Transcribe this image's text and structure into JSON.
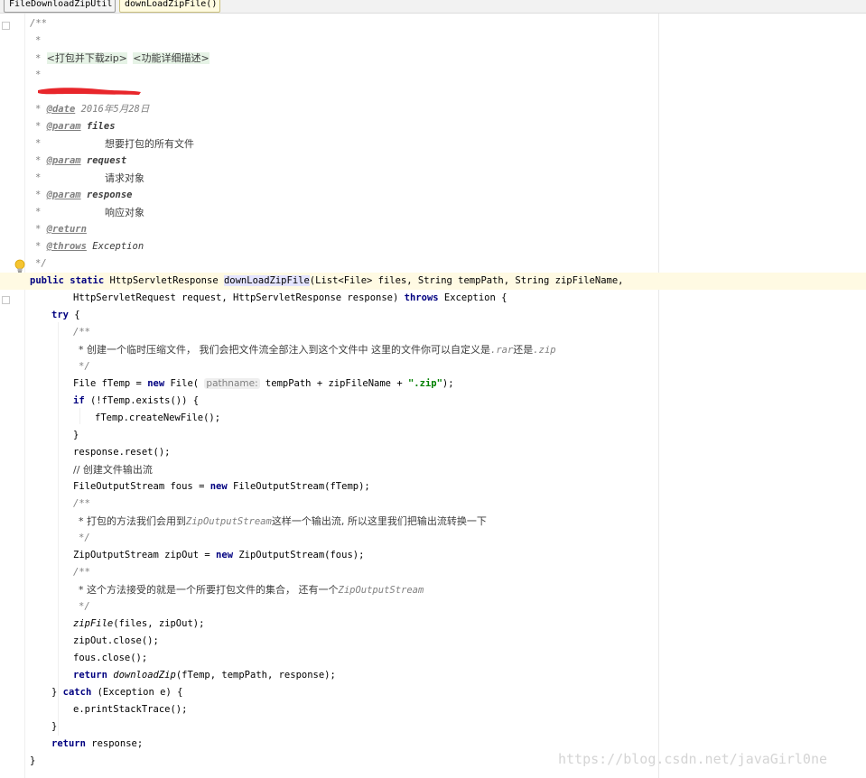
{
  "breadcrumb": {
    "class_name": "FileDownloadZipUtil",
    "method_name": "downLoadZipFile()"
  },
  "code": {
    "l01": "/**",
    "l02": "*",
    "l03_prefix": "* ",
    "l03_tag1": "<打包并下载zip>",
    "l03_tag2": "<功能详细描述>",
    "l04": "*",
    "l06_prefix": "* ",
    "l06_tag": "@date",
    "l06_value": " 2016年5月28日",
    "l07_tag": "@param",
    "l07_name": " files",
    "l08": "想要打包的所有文件",
    "l09_tag": "@param",
    "l09_name": " request",
    "l10": "请求对象",
    "l11_tag": "@param",
    "l11_name": " response",
    "l12": "响应对象",
    "l13_tag": "@return",
    "l14_tag": "@throws",
    "l14_name": " Exception",
    "l15": "*/",
    "l16_kw1": "public",
    "l16_kw2": "static",
    "l16_type": "HttpServletResponse",
    "l16_method": "downLoadZipFile",
    "l16_rest": "(List<File> files, String tempPath, String zipFileName,",
    "l17_rest": "HttpServletRequest request, HttpServletResponse response) ",
    "l17_kw": "throws",
    "l17_tail": " Exception {",
    "l18_kw": "try",
    "l18_tail": " {",
    "l19": "/**",
    "l20": "* 创建一个临时压缩文件， 我们会把文件流全部注入到这个文件中 这里的文件你可以自定义是",
    "l20_a": ".rar",
    "l20_b": "还是",
    "l20_c": ".zip",
    "l21": "*/",
    "l22_a": "File fTemp = ",
    "l22_kw": "new",
    "l22_b": " File( ",
    "l22_hint": "pathname:",
    "l22_c": " tempPath + zipFileName + ",
    "l22_str": "\".zip\"",
    "l22_d": ");",
    "l23_kw": "if",
    "l23_rest": " (!fTemp.exists()) {",
    "l24": "fTemp.createNewFile();",
    "l25": "}",
    "l26": "response.reset();",
    "l27": "// 创建文件输出流",
    "l28_a": "FileOutputStream fous = ",
    "l28_kw": "new",
    "l28_b": " FileOutputStream(fTemp);",
    "l29": "/**",
    "l30_a": "* 打包的方法我们会用到",
    "l30_b": "ZipOutputStream",
    "l30_c": "这样一个输出流, 所以这里我们把输出流转换一下",
    "l31": "*/",
    "l32_a": "ZipOutputStream zipOut = ",
    "l32_kw": "new",
    "l32_b": " ZipOutputStream(fous);",
    "l33": "/**",
    "l34_a": "* 这个方法接受的就是一个所要打包文件的集合， 还有一个",
    "l34_b": "ZipOutputStream",
    "l35": "*/",
    "l36_a": "zipFile",
    "l36_b": "(files, zipOut);",
    "l37": "zipOut.close();",
    "l38": "fous.close();",
    "l39_kw": "return",
    "l39_a": " ",
    "l39_method": "downloadZip",
    "l39_b": "(fTemp, tempPath, response);",
    "l40_a": "} ",
    "l40_kw": "catch",
    "l40_b": " (Exception e) {",
    "l41": "e.printStackTrace();",
    "l42": "}",
    "l43_kw": "return",
    "l43_b": " response;",
    "l44": "}"
  },
  "watermark": "https://blog.csdn.net/javaGirl0ne",
  "colors": {
    "keyword": "#000080",
    "string": "#008000",
    "comment": "#808080",
    "caret_line": "#fffae3",
    "redaction": "#e8262b"
  }
}
